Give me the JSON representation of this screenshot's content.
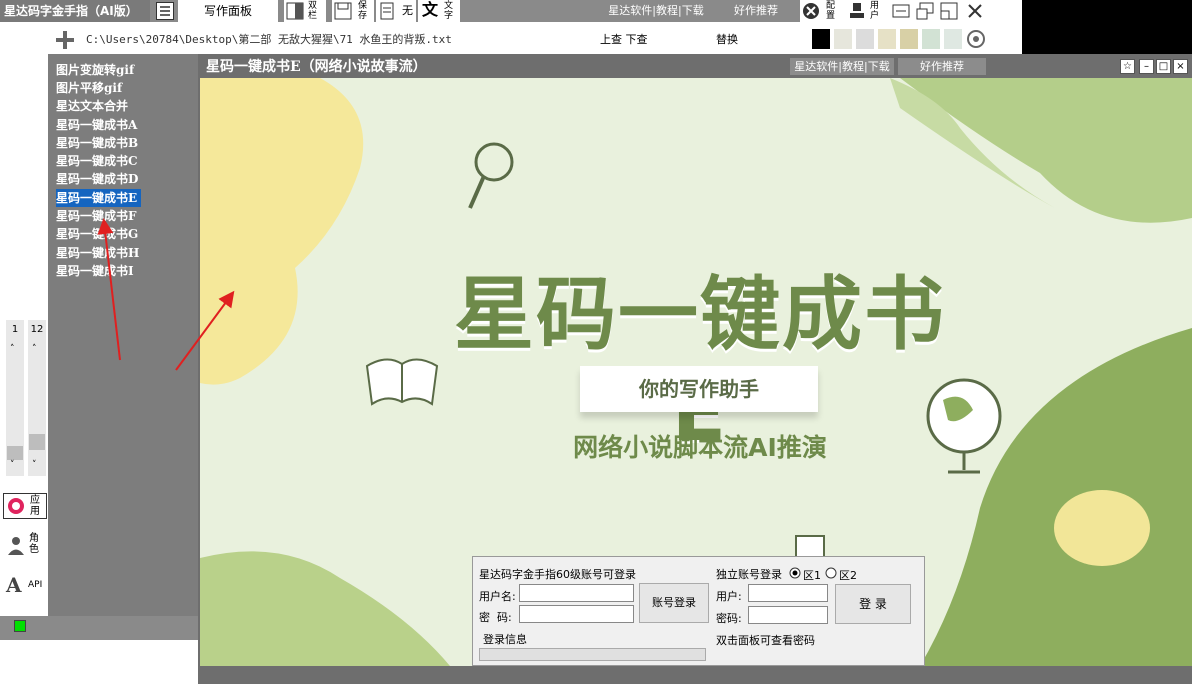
{
  "toolbar": {
    "app_title": "星达码字金手指（AI版）",
    "write_panel": "写作面板",
    "dual_col": "双\n栏",
    "save": "保\n存",
    "none": "无",
    "text": "文\n字",
    "software_links": "星达软件|教程|下载",
    "recommend": "好作推荐",
    "config": "配\n置",
    "user": "用\n户"
  },
  "row2": {
    "file_path": "C:\\Users\\20784\\Desktop\\第二部 无敌大猩猩\\71 水鱼王的背叛.txt",
    "search_up_down": "上查 下查",
    "replace": "替换",
    "swatches": [
      "#000000",
      "#e6e6dc",
      "#dcdcdc",
      "#e6e1c6",
      "#d8d0a6",
      "#d2e2d4",
      "#dfe8e2"
    ]
  },
  "leftlist": {
    "items": [
      "图片变旋转gif",
      "图片平移gif",
      "星达文本合并",
      "星码一键成书A",
      "星码一键成书B",
      "星码一键成书C",
      "星码一键成书D",
      "星码一键成书E",
      "星码一键成书F",
      "星码一键成书G",
      "星码一键成书H",
      "星码一键成书I"
    ],
    "selected_index": 7
  },
  "leftstrip": {
    "num1": "1",
    "num2": "12",
    "apply": "应\n用",
    "role": "角\n色",
    "api": "API"
  },
  "window": {
    "title": "星码一键成书E（网络小说故事流）",
    "links": "星达软件|教程|下载",
    "recommend": "好作推荐"
  },
  "banner": {
    "main_title": "星码一键成书E",
    "subtitle_box": "你的写作助手",
    "tagline": "网络小说脚本流AI推演"
  },
  "login": {
    "header": "星达码字金手指60级账号可登录",
    "username_label": "用户名:",
    "password_label": "密  码:",
    "account_login": "账号登录",
    "login_info": "登录信息",
    "independent": "独立账号登录",
    "zone1": "区1",
    "zone2": "区2",
    "user_label": "用户:",
    "pass_label": "密码:",
    "login_btn": "登 录",
    "hint": "双击面板可查看密码"
  }
}
